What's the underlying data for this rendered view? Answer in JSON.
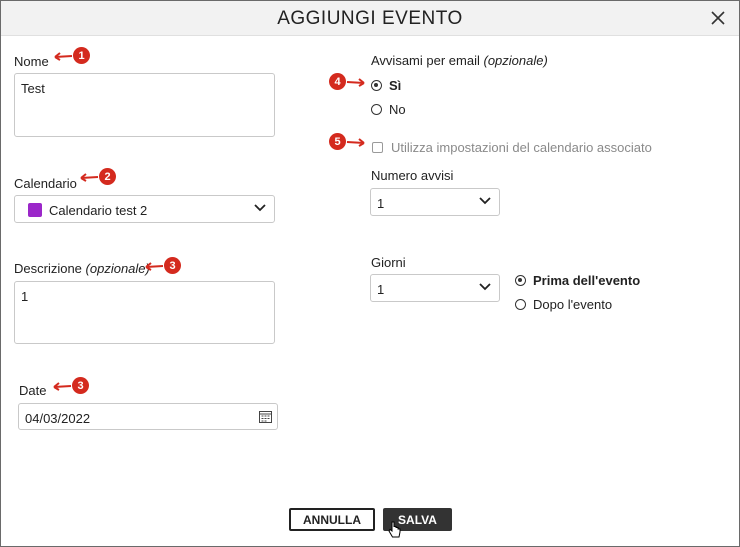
{
  "dialog": {
    "title": "AGGIUNGI EVENTO"
  },
  "left": {
    "nome": {
      "label": "Nome",
      "value": "Test"
    },
    "calendario": {
      "label": "Calendario",
      "value": "Calendario test 2",
      "swatch_color": "#9b27c9"
    },
    "descrizione": {
      "label": "Descrizione",
      "optional": "(opzionale)",
      "value": "1"
    },
    "date": {
      "label": "Date",
      "value": "04/03/2022"
    }
  },
  "right": {
    "email": {
      "label": "Avvisami per email",
      "optional": "(opzionale)",
      "options": [
        {
          "label": "Sì",
          "selected": true
        },
        {
          "label": "No",
          "selected": false
        }
      ]
    },
    "use_calendar_settings": {
      "label": "Utilizza impostazioni del calendario associato",
      "checked": false
    },
    "numero_avvisi": {
      "label": "Numero avvisi",
      "value": "1"
    },
    "giorni": {
      "label": "Giorni",
      "value": "1",
      "options": [
        {
          "label": "Prima dell'evento",
          "selected": true
        },
        {
          "label": "Dopo l'evento",
          "selected": false
        }
      ]
    }
  },
  "markers": [
    "1",
    "2",
    "3",
    "3",
    "4",
    "5"
  ],
  "buttons": {
    "cancel": "ANNULLA",
    "save": "SALVA"
  }
}
